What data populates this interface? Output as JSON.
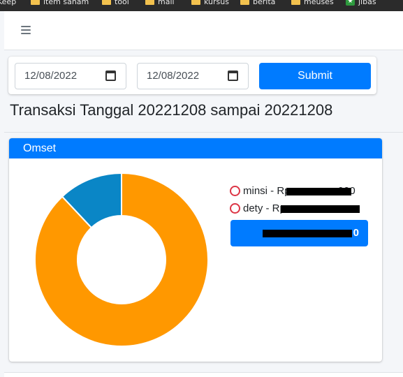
{
  "bookmarks": [
    {
      "label": "Keep",
      "icon": "bookmark-icon"
    },
    {
      "label": "item sanam",
      "icon": "folder-icon"
    },
    {
      "label": "tool",
      "icon": "folder-icon"
    },
    {
      "label": "mail",
      "icon": "folder-icon"
    },
    {
      "label": "kursus",
      "icon": "folder-icon"
    },
    {
      "label": "berita",
      "icon": "folder-icon"
    },
    {
      "label": "meuses",
      "icon": "folder-icon"
    },
    {
      "label": "jibas",
      "icon": "star-icon"
    }
  ],
  "navbar": {
    "menu_icon": "hamburger-icon"
  },
  "filter": {
    "start_date": "12/08/2022",
    "end_date": "12/08/2022",
    "submit_label": "Submit"
  },
  "page": {
    "title": "Transaksi Tanggal 20221208 sampai 20221208"
  },
  "omset": {
    "header": "Omset",
    "legend": [
      {
        "label": "minsi - Rp",
        "visible_suffix": ",000",
        "color": "#dc3545"
      },
      {
        "label": "dety - Rp",
        "visible_suffix": "",
        "color": "#dc3545"
      }
    ],
    "total_label": "0",
    "colors": {
      "accent": "#007bff",
      "slice_large": "#ff9800",
      "slice_small": "#0a86c6"
    }
  },
  "chart_data": {
    "type": "pie",
    "style": "donut",
    "title": "",
    "categories": [
      "minsi",
      "dety"
    ],
    "values": [
      88,
      12
    ],
    "colors": [
      "#ff9800",
      "#0a86c6"
    ]
  }
}
